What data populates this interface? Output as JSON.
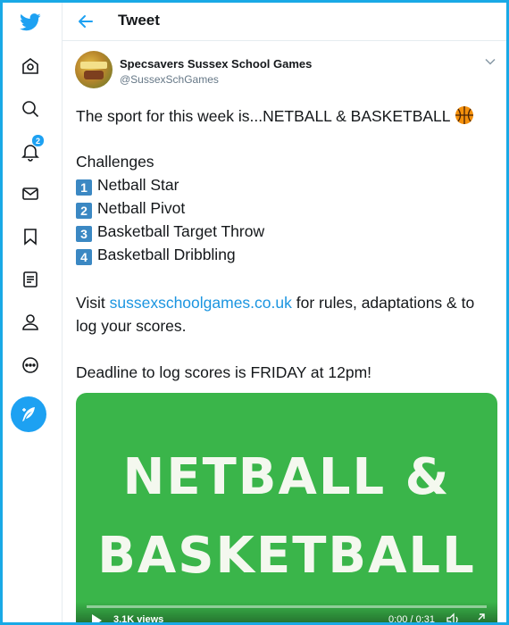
{
  "header": {
    "title": "Tweet"
  },
  "nav": {
    "notifications_count": "2"
  },
  "tweet": {
    "author_name": "Specsavers Sussex School Games",
    "author_handle": "@SussexSchGames",
    "line1": "The sport for this week is...NETBALL & BASKETBALL",
    "challenges_heading": "Challenges",
    "challenges": [
      {
        "num": "1",
        "label": "Netball Star"
      },
      {
        "num": "2",
        "label": "Netball Pivot"
      },
      {
        "num": "3",
        "label": "Basketball Target Throw"
      },
      {
        "num": "4",
        "label": "Basketball Dribbling"
      }
    ],
    "visit_prefix": "Visit ",
    "visit_link": "sussexschoolgames.co.uk",
    "visit_suffix": " for rules, adaptations & to",
    "visit_line2": "log your scores.",
    "deadline": "Deadline to log scores is FRIDAY at 12pm!"
  },
  "media": {
    "line1": "NETBALL &",
    "line2": "BASKETBALL",
    "views": "3.1K views",
    "time": "0:00 / 0:31",
    "background_color": "#3ab54a"
  },
  "colors": {
    "accent": "#1da1f2",
    "border": "#19a9e6",
    "link": "#1b95e0",
    "keycap": "#3b88c3"
  }
}
